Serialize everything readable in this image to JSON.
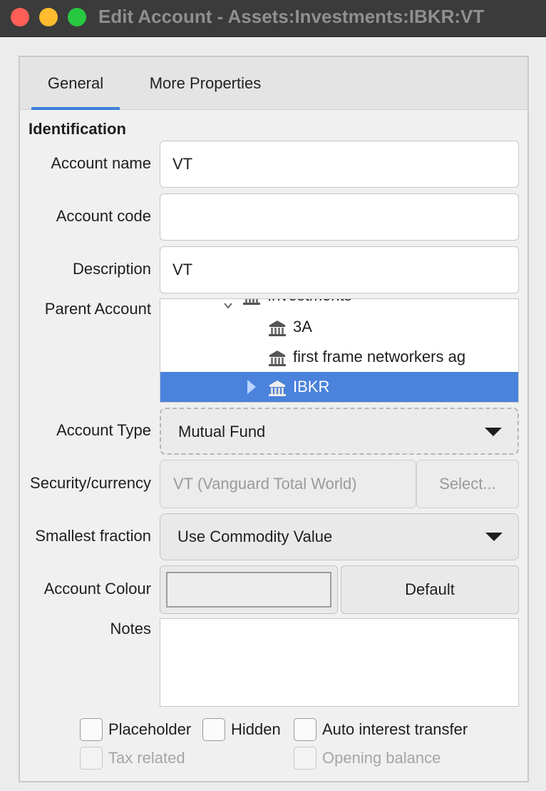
{
  "window": {
    "title": "Edit Account - Assets:Investments:IBKR:VT",
    "buttons": [
      "close",
      "minimize",
      "zoom"
    ]
  },
  "tabs": [
    {
      "label": "General",
      "active": true
    },
    {
      "label": "More Properties",
      "active": false
    }
  ],
  "form": {
    "section_title": "Identification",
    "account_name": {
      "label": "Account name",
      "value": "VT"
    },
    "account_code": {
      "label": "Account code",
      "value": ""
    },
    "description": {
      "label": "Description",
      "value": "VT"
    },
    "parent_account": {
      "label": "Parent Account",
      "tree": [
        {
          "label": "Investments",
          "partial": true,
          "expanded": true
        },
        {
          "label": "3A"
        },
        {
          "label": "first frame networkers ag"
        },
        {
          "label": "IBKR",
          "selected": true,
          "collapsed": true
        }
      ]
    },
    "account_type": {
      "label": "Account Type",
      "value": "Mutual Fund"
    },
    "security": {
      "label": "Security/currency",
      "value": "VT (Vanguard Total World)",
      "button": "Select..."
    },
    "smallest_fraction": {
      "label": "Smallest fraction",
      "value": "Use Commodity Value"
    },
    "account_colour": {
      "label": "Account Colour",
      "default_button": "Default"
    },
    "notes": {
      "label": "Notes",
      "value": ""
    }
  },
  "checkboxes": [
    {
      "label": "Placeholder",
      "checked": false,
      "enabled": true
    },
    {
      "label": "Hidden",
      "checked": false,
      "enabled": true
    },
    {
      "label": "Auto interest transfer",
      "checked": false,
      "enabled": true
    },
    {
      "label": "Tax related",
      "checked": false,
      "enabled": false
    },
    {
      "label": "Opening balance",
      "checked": false,
      "enabled": false
    }
  ],
  "colors": {
    "accent": "#3c7fd8",
    "selection": "#4a82dc",
    "titlebar": "#3b3b3b"
  }
}
